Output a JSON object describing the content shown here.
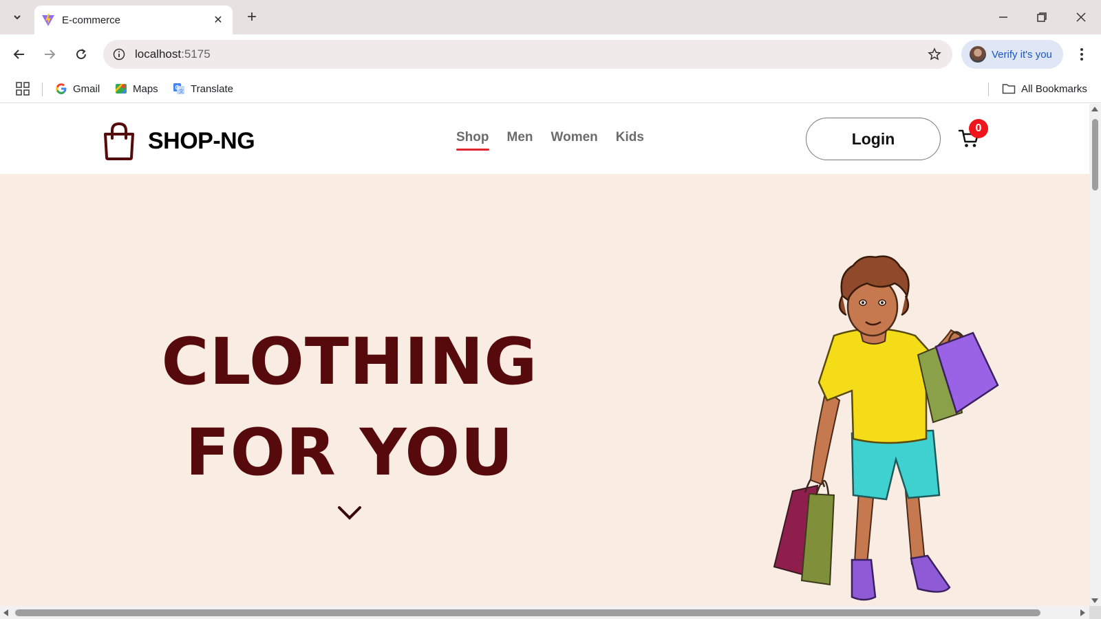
{
  "browser": {
    "tab": {
      "title": "E-commerce",
      "favicon": "vite-icon"
    },
    "address_bar": {
      "host": "localhost",
      "port": ":5175"
    },
    "profile": {
      "label": "Verify it's you"
    },
    "bookmarks": [
      {
        "label": "Gmail",
        "icon": "google-icon"
      },
      {
        "label": "Maps",
        "icon": "maps-icon"
      },
      {
        "label": "Translate",
        "icon": "translate-icon"
      }
    ],
    "all_bookmarks_label": "All Bookmarks"
  },
  "site": {
    "brand": "SHOP-NG",
    "nav": [
      {
        "label": "Shop",
        "active": true
      },
      {
        "label": "Men",
        "active": false
      },
      {
        "label": "Women",
        "active": false
      },
      {
        "label": "Kids",
        "active": false
      }
    ],
    "login_label": "Login",
    "cart_count": "0"
  },
  "hero": {
    "line1": "CLOTHING",
    "line2": "FOR YOU"
  },
  "colors": {
    "brand_dark_red": "#560a0c",
    "hero_bg": "#f9ede3",
    "nav_active_underline": "#e0262a",
    "cart_badge": "#f0141c"
  }
}
